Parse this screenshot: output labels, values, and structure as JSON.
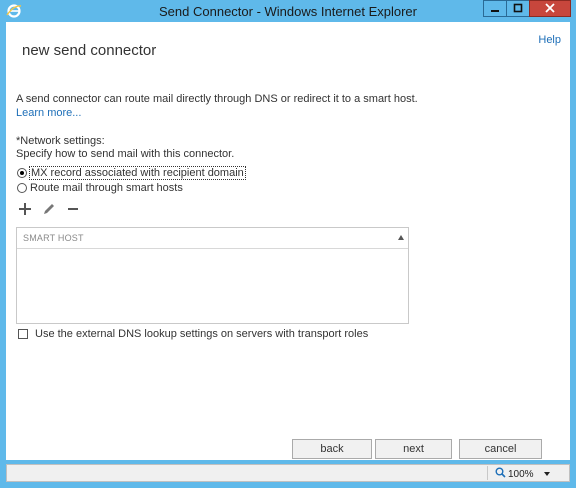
{
  "window": {
    "title": "Send Connector - Windows Internet Explorer"
  },
  "page": {
    "title": "new send connector",
    "help_link": "Help",
    "description": "A send connector can route mail directly through DNS or redirect it to a smart host.",
    "learn_more": "Learn more..."
  },
  "network": {
    "label": "*Network settings:",
    "sublabel": "Specify how to send mail with this connector.",
    "options": [
      {
        "label": "MX record associated with recipient domain",
        "selected": true
      },
      {
        "label": "Route mail through smart hosts",
        "selected": false
      }
    ]
  },
  "toolbar": {
    "icons": [
      "add-icon",
      "edit-icon",
      "remove-icon"
    ]
  },
  "grid": {
    "column_header": "SMART HOST",
    "rows": []
  },
  "dns_option": {
    "label": "Use the external DNS lookup settings on servers with transport roles",
    "checked": false
  },
  "buttons": {
    "back": "back",
    "next": "next",
    "cancel": "cancel"
  },
  "statusbar": {
    "zoom": "100%"
  }
}
